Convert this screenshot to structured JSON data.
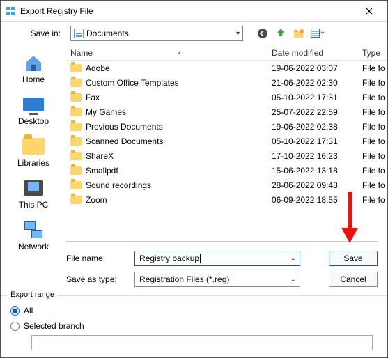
{
  "window": {
    "title": "Export Registry File"
  },
  "top": {
    "savein_label": "Save in:",
    "savein_value": "Documents"
  },
  "columns": {
    "name": "Name",
    "date": "Date modified",
    "type": "Type"
  },
  "places": {
    "home": "Home",
    "desktop": "Desktop",
    "libraries": "Libraries",
    "thispc": "This PC",
    "network": "Network"
  },
  "rows": [
    {
      "name": "Adobe",
      "date": "19-06-2022 03:07",
      "type": "File fo"
    },
    {
      "name": "Custom Office Templates",
      "date": "21-06-2022 02:30",
      "type": "File fo"
    },
    {
      "name": "Fax",
      "date": "05-10-2022 17:31",
      "type": "File fo"
    },
    {
      "name": "My Games",
      "date": "25-07-2022 22:59",
      "type": "File fo"
    },
    {
      "name": "Previous Documents",
      "date": "19-06-2022 02:38",
      "type": "File fo"
    },
    {
      "name": "Scanned Documents",
      "date": "05-10-2022 17:31",
      "type": "File fo"
    },
    {
      "name": "ShareX",
      "date": "17-10-2022 16:23",
      "type": "File fo"
    },
    {
      "name": "Smallpdf",
      "date": "15-06-2022 13:18",
      "type": "File fo"
    },
    {
      "name": "Sound recordings",
      "date": "28-06-2022 09:48",
      "type": "File fo"
    },
    {
      "name": "Zoom",
      "date": "06-09-2022 18:55",
      "type": "File fo"
    }
  ],
  "fields": {
    "filename_label": "File name:",
    "filename_value": "Registry backup",
    "savetype_label": "Save as type:",
    "savetype_value": "Registration Files (*.reg)"
  },
  "buttons": {
    "save": "Save",
    "cancel": "Cancel"
  },
  "export": {
    "legend": "Export range",
    "all": "All",
    "selected": "Selected branch"
  }
}
